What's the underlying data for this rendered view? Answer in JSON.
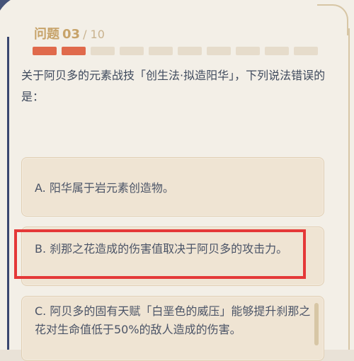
{
  "question_header": {
    "label": "问题",
    "current": "03",
    "total": "/ 10"
  },
  "progress": {
    "current": 2,
    "total": 10
  },
  "question_text": "关于阿贝多的元素战技「创生法·拟造阳华」，下列说法错误的是：",
  "options": [
    {
      "label": "A. 阳华属于岩元素创造物。"
    },
    {
      "label": "B. 刹那之花造成的伤害值取决于阿贝多的攻击力。"
    },
    {
      "label": "C. 阿贝多的固有天赋「白垩色的威压」能够提升刹那之花对生命值低于50%的敌人造成的伤害。"
    }
  ],
  "colors": {
    "accent": "#e06a4c",
    "highlight_box": "#e43838"
  }
}
